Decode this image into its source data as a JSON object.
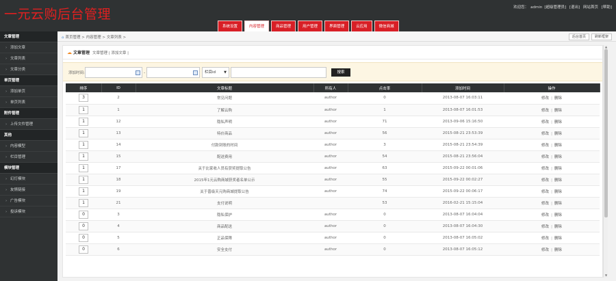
{
  "header": {
    "logo": "一元云购后台管理",
    "welcome": "欢迎您：",
    "username": "admin",
    "role": "[超级管理员]",
    "links": [
      "[退出]",
      "网站首页",
      "[帮助]"
    ]
  },
  "nav": {
    "items": [
      "系统设置",
      "内容管理",
      "商品管理",
      "用户管理",
      "界面管理",
      "云应用",
      "微信商城"
    ],
    "active_index": 1
  },
  "sidebar": {
    "groups": [
      {
        "title": "文章管理",
        "items": [
          "添加文章",
          "文章列表",
          "文章分类"
        ]
      },
      {
        "title": "单页管理",
        "items": [
          "添加单页",
          "单页列表"
        ]
      },
      {
        "title": "附件管理",
        "items": [
          "上传文件管理"
        ]
      },
      {
        "title": "其他",
        "items": [
          "内容模型",
          "栏目管理"
        ]
      },
      {
        "title": "模块管理",
        "items": [
          "幻灯模块",
          "友情链接",
          "广告模块",
          "投诉模块"
        ]
      }
    ]
  },
  "breadcrumb": {
    "path": "首页管理 > 内容管理 > 文章列表 >",
    "buttons": [
      "后台首页",
      "刷新框架"
    ]
  },
  "panel": {
    "title": "文章管理",
    "sub_links": "文章管理 | 添加文章 |"
  },
  "search": {
    "label": "添加时间:",
    "dash": "-",
    "select_value": "栏目id",
    "button": "搜索"
  },
  "table": {
    "headers": [
      "排序",
      "ID",
      "文章标题",
      "所有人",
      "点击率",
      "添加时间",
      "操作"
    ],
    "rows": [
      {
        "sort": "3",
        "id": "2",
        "title": "常见问题",
        "owner": "author",
        "hits": "0",
        "time": "2013-08-07 16:03:11"
      },
      {
        "sort": "1",
        "id": "1",
        "title": "了解云购",
        "owner": "author",
        "hits": "1",
        "time": "2013-08-07 16:01:53"
      },
      {
        "sort": "1",
        "id": "12",
        "title": "隐私声明",
        "owner": "author",
        "hits": "71",
        "time": "2013-09-06 15:16:50"
      },
      {
        "sort": "1",
        "id": "13",
        "title": "特价商品",
        "owner": "author",
        "hits": "56",
        "time": "2015-08-21 23:53:39"
      },
      {
        "sort": "1",
        "id": "14",
        "title": "付款到账的时间",
        "owner": "author",
        "hits": "3",
        "time": "2015-08-21 23:54:39"
      },
      {
        "sort": "1",
        "id": "15",
        "title": "配送费用",
        "owner": "author",
        "hits": "54",
        "time": "2015-08-21 23:56:04"
      },
      {
        "sort": "1",
        "id": "17",
        "title": "关于比家收人员有获奖提取公告",
        "owner": "author",
        "hits": "63",
        "time": "2015-09-22 00:01:06"
      },
      {
        "sort": "1",
        "id": "18",
        "title": "2015年1元云购商城获奖者名单公示",
        "owner": "author",
        "hits": "55",
        "time": "2015-09-22 00:02:27"
      },
      {
        "sort": "1",
        "id": "19",
        "title": "关于晋级天元购商城提取公告",
        "owner": "author",
        "hits": "74",
        "time": "2015-09-22 00:06:17"
      },
      {
        "sort": "1",
        "id": "21",
        "title": "支付说明",
        "owner": "",
        "hits": "53",
        "time": "2016-02-21 15:15:04"
      },
      {
        "sort": "0",
        "id": "3",
        "title": "隐私保护",
        "owner": "author",
        "hits": "0",
        "time": "2013-08-07 16:04:04"
      },
      {
        "sort": "0",
        "id": "4",
        "title": "商品配送",
        "owner": "author",
        "hits": "0",
        "time": "2013-08-07 16:04:30"
      },
      {
        "sort": "0",
        "id": "5",
        "title": "正品保障",
        "owner": "author",
        "hits": "0",
        "time": "2013-08-07 16:05:02"
      },
      {
        "sort": "0",
        "id": "6",
        "title": "安全支付",
        "owner": "author",
        "hits": "0",
        "time": "2013-08-07 16:05:12"
      }
    ],
    "edit_label": "修改",
    "delete_label": "删除",
    "sep": "|"
  },
  "colors": {
    "header_bg": "#2f3233",
    "nav_red": "#d81f26",
    "logo_red": "#e02020",
    "search_bg": "#fdf6e3"
  }
}
